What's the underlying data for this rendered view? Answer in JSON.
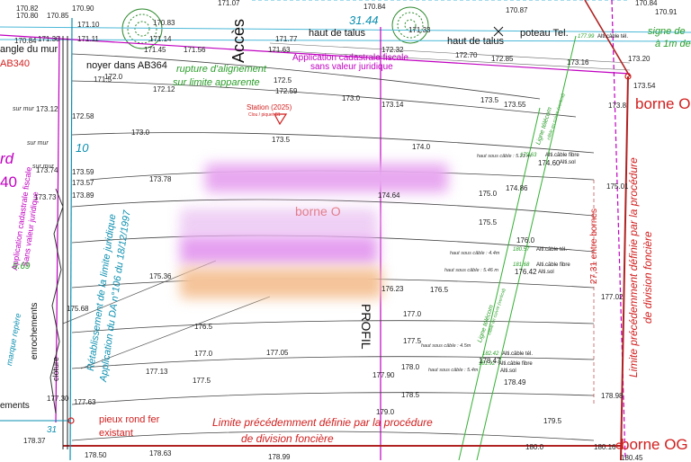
{
  "labels": {
    "acces": "Accès",
    "haut_talus_1": "haut de talus",
    "haut_talus_2": "haut de talus",
    "poteau_tel": "poteau Tel.",
    "angle_mur": "angle du mur",
    "ab340": "AB340",
    "noyer": "noyer dans AB364",
    "rupture_1": "rupture d'alignement",
    "rupture_2": "sur limite apparente",
    "app_cad_top_1": "Application cadastrale fiscale",
    "app_cad_top_2": "sans valeur juridique",
    "station": "Station (2025)",
    "station_sub": "Clou / piquet S1",
    "borne_top": "borne O",
    "borne_mid": "borne O",
    "borne_bot": "borne OG",
    "signe_1": "signe de",
    "signe_2": "à 1m de",
    "profil": "PROFIL",
    "ligne_tel_1": "Ligne télécom",
    "ligne_tel_1b": "câble en cuivre (vertical)",
    "ligne_tel_2": "Ligne télécom",
    "ligne_tel_2b": "câble en cuivre (vertical)",
    "entre_bornes": "27,31 entre bornes",
    "limite_right_1": "Limite précédemment définie par la procédure",
    "limite_right_2": "de division foncière",
    "limite_bottom_1": "Limite précédemment définie par la procédure",
    "limite_bottom_2": "de division foncière",
    "retab_1": "Rétablissement de la limite juridique",
    "retab_2": "Application du DA n°106 du 18/12/1997",
    "app_cad_left_1": "Application cadastrale fiscale",
    "app_cad_left_2": "Sans valeur juridique",
    "sur_mur_1": "sur mur",
    "sur_mur_2": "sur mur",
    "sur_mur_3": "sur mur",
    "d_left": "rd",
    "n40": "40",
    "n669": "6.69",
    "n10": "10",
    "n31": "31",
    "marque": "marque repère",
    "enroch_1": "enrochements",
    "enroch_2": "ements",
    "cloture": "clôture",
    "pieux_1": "pieux rond fer",
    "pieux_2": "existant",
    "cable_1": "haut sous câble : 5.23 m",
    "cable_2": "haut sous câble : 4.4m",
    "cable_3": "haut sous câble : 5.46 m",
    "cable_4": "haut sous câble : 4.5m",
    "cable_5": "haut sous câble : 5.4m",
    "alti_fibre": "Alti.câble fibre",
    "alti_sol": "Alti.sol",
    "alti_tel": "Alti.câble tél.",
    "dist_3144": "31.44"
  },
  "elevations": [
    "170.82",
    "170.85",
    "170.90",
    "170.84",
    "170.87",
    "170.91",
    "170.84",
    "171.07",
    "170.80",
    "171.10",
    "170.83",
    "170.84",
    "171.30",
    "171.14",
    "171.11",
    "171.33",
    "171.77",
    "172.32",
    "172.70",
    "172.85",
    "173.16",
    "173.20",
    "173.54",
    "173.8",
    "171.45",
    "171.56",
    "171.63",
    "171.5",
    "172.0",
    "172.12",
    "172.5",
    "172.59",
    "173.0",
    "173.14",
    "173.5",
    "173.55",
    "173.12",
    "172.58",
    "173.0",
    "173.5",
    "174.0",
    "173.74",
    "173.59",
    "173.57",
    "173.89",
    "173.78",
    "173.73",
    "174.64",
    "175.0",
    "174.86",
    "175.5",
    "175.01",
    "175.36",
    "176.0",
    "176.5",
    "177.0",
    "177.05",
    "175.68",
    "176.5",
    "177.0",
    "177.5",
    "177.13",
    "177.5",
    "177.90",
    "178.0",
    "178.47",
    "178.49",
    "178.5",
    "178.98",
    "179.0",
    "179.5",
    "180.0",
    "180.16",
    "180.45",
    "178.37",
    "178.50",
    "178.63",
    "178.99",
    "177.63",
    "177.30",
    "177.02",
    "176.42",
    "174.60",
    "176.23"
  ],
  "cable_values": {
    "v1": "179.63",
    "v2": "180.57",
    "v3": "181.68",
    "v4": "182.42",
    "v5": "181.92",
    "v6": "177.99"
  }
}
